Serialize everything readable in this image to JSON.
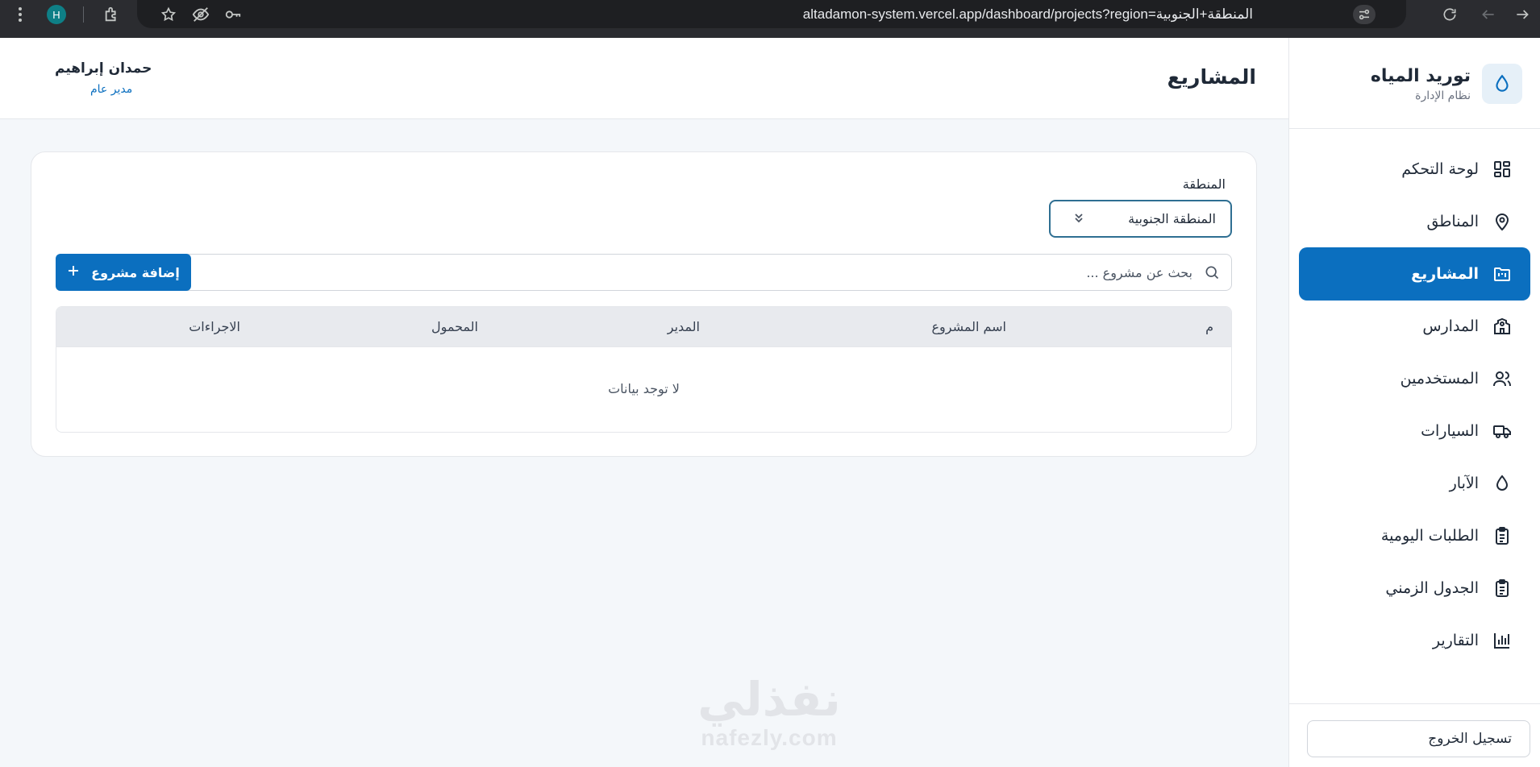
{
  "browser": {
    "url": "altadamon-system.vercel.app/dashboard/projects?region=المنطقة+الجنوبية",
    "profile_initial": "H"
  },
  "sidebar": {
    "brand_title": "توريد المياه",
    "brand_subtitle": "نظام الإدارة",
    "items": [
      {
        "label": "لوحة التحكم",
        "icon": "dashboard-icon",
        "active": false
      },
      {
        "label": "المناطق",
        "icon": "map-pin-icon",
        "active": false
      },
      {
        "label": "المشاريع",
        "icon": "folder-kanban-icon",
        "active": true
      },
      {
        "label": "المدارس",
        "icon": "school-icon",
        "active": false
      },
      {
        "label": "المستخدمين",
        "icon": "users-icon",
        "active": false
      },
      {
        "label": "السيارات",
        "icon": "truck-icon",
        "active": false
      },
      {
        "label": "الآبار",
        "icon": "droplet-icon",
        "active": false
      },
      {
        "label": "الطلبات اليومية",
        "icon": "clipboard-icon",
        "active": false
      },
      {
        "label": "الجدول الزمني",
        "icon": "clipboard-list-icon",
        "active": false
      },
      {
        "label": "التقارير",
        "icon": "bar-chart-icon",
        "active": false
      }
    ],
    "logout_label": "تسجيل الخروج"
  },
  "header": {
    "title": "المشاريع",
    "user_name": "حمدان إبراهيم",
    "user_role": "مدير عام"
  },
  "filters": {
    "region_label": "المنطقة",
    "region_value": "المنطقة الجنوبية"
  },
  "search": {
    "placeholder": "بحث عن مشروع ..."
  },
  "add_button": {
    "label": "إضافة مشروع"
  },
  "table": {
    "columns": [
      "م",
      "اسم المشروع",
      "المدير",
      "المحمول",
      "الاجراءات"
    ],
    "empty_message": "لا توجد بيانات"
  },
  "watermark": {
    "arabic": "نفذلي",
    "latin": "nafezly.com"
  },
  "colors": {
    "primary": "#0b6fbf",
    "background": "#f4f7fa"
  }
}
